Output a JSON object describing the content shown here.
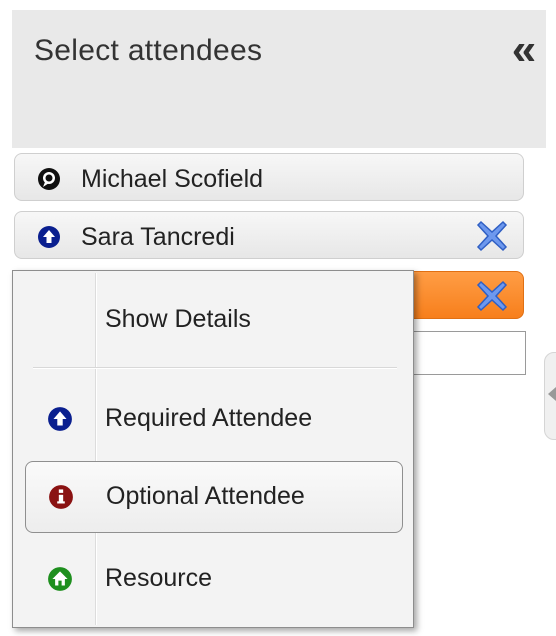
{
  "header": {
    "title": "Select attendees",
    "collapse_glyph": "«"
  },
  "attendees": [
    {
      "name": "Michael Scofield",
      "icon": "organizer-icon",
      "removable": false
    },
    {
      "name": "Sara Tancredi",
      "icon": "required-attendee-icon",
      "removable": true
    },
    {
      "name": "",
      "icon": "",
      "removable": true,
      "highlighted": true
    }
  ],
  "context_menu": {
    "items": [
      {
        "label": "Show Details",
        "icon": ""
      },
      {
        "label": "Required Attendee",
        "icon": "required-attendee-icon"
      },
      {
        "label": "Optional Attendee",
        "icon": "optional-attendee-icon"
      },
      {
        "label": "Resource",
        "icon": "resource-icon"
      }
    ]
  },
  "colors": {
    "required": "#0a1f8f",
    "optional": "#8a1212",
    "resource": "#1e8f1e",
    "highlight": "#f78a2a",
    "remove": "#4f7fe0"
  }
}
